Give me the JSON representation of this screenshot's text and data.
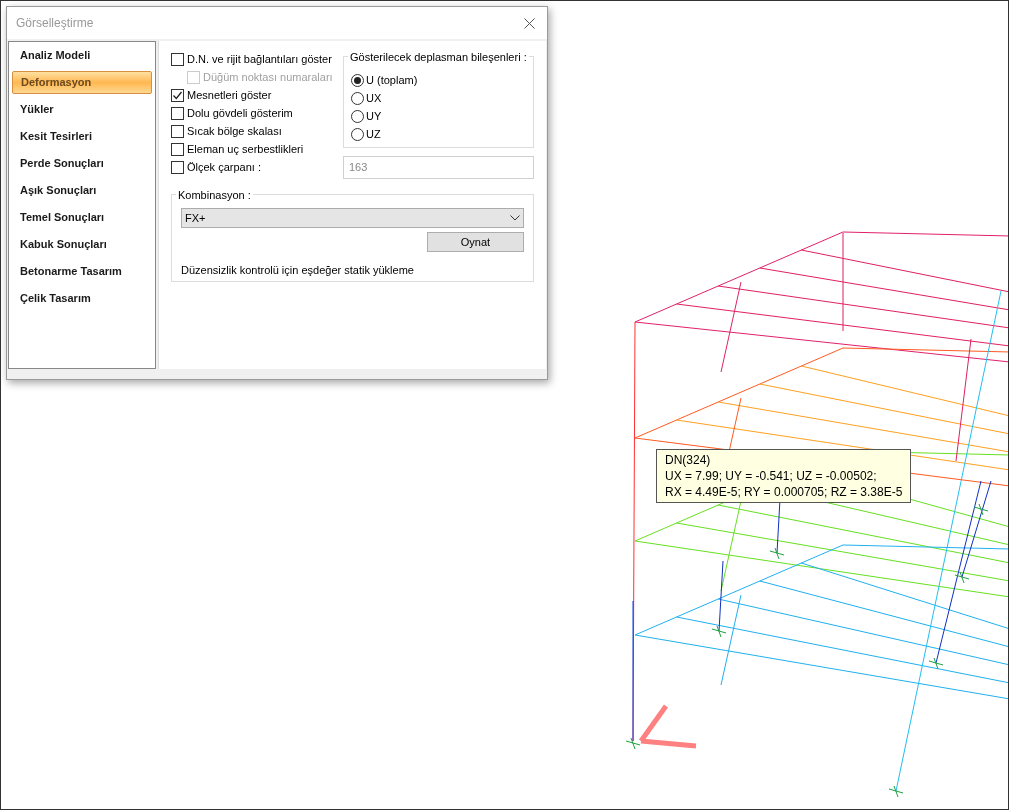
{
  "window": {
    "title": "Görselleştirme"
  },
  "sidebar": {
    "items": [
      {
        "label": "Analiz Modeli",
        "selected": false
      },
      {
        "label": "Deformasyon",
        "selected": true
      },
      {
        "label": "Yükler",
        "selected": false
      },
      {
        "label": "Kesit Tesirleri",
        "selected": false
      },
      {
        "label": "Perde Sonuçları",
        "selected": false
      },
      {
        "label": "Aşık Sonuçları",
        "selected": false
      },
      {
        "label": "Temel Sonuçları",
        "selected": false
      },
      {
        "label": "Kabuk Sonuçları",
        "selected": false
      },
      {
        "label": "Betonarme Tasarım",
        "selected": false
      },
      {
        "label": "Çelik Tasarım",
        "selected": false
      }
    ]
  },
  "options": [
    {
      "label": "D.N. ve rijit bağlantıları göster",
      "checked": false,
      "disabled": false,
      "children": [
        {
          "label": "Düğüm noktası numaraları",
          "checked": false,
          "disabled": true
        }
      ]
    },
    {
      "label": "Mesnetleri göster",
      "checked": true,
      "disabled": false
    },
    {
      "label": "Dolu gövdeli gösterim",
      "checked": false,
      "disabled": false
    },
    {
      "label": "Sıcak bölge skalası",
      "checked": false,
      "disabled": false
    },
    {
      "label": "Eleman uç serbestlikleri",
      "checked": false,
      "disabled": false
    },
    {
      "label": "Ölçek çarpanı :",
      "checked": false,
      "disabled": false
    }
  ],
  "displacement_components": {
    "title": "Gösterilecek deplasman bileşenleri :",
    "options": [
      {
        "label": "U (toplam)",
        "selected": true
      },
      {
        "label": "UX",
        "selected": false
      },
      {
        "label": "UY",
        "selected": false
      },
      {
        "label": "UZ",
        "selected": false
      }
    ]
  },
  "scale_field": {
    "value": "163",
    "disabled": true
  },
  "combination": {
    "title": "Kombinasyon :",
    "value": "FX+",
    "button": "Oynat",
    "note": "Düzensizlik kontrolü için eşdeğer statik yükleme"
  },
  "tooltip": {
    "lines": [
      "DN(324)",
      "UX = 7.99; UY = -0.541; UZ = -0.00502;",
      "RX = 4.49E-5; RY = 0.000705; RZ = 3.38E-5"
    ]
  }
}
